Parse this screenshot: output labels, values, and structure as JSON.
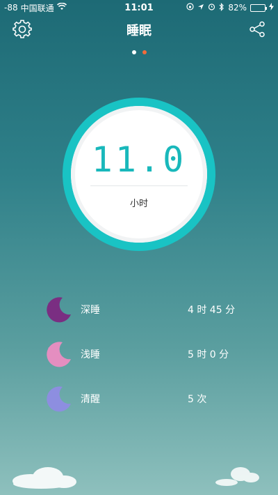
{
  "status_bar": {
    "signal": "-88",
    "carrier": "中国联通",
    "time": "11:01",
    "battery": "82%",
    "battery_level": 0.82
  },
  "nav": {
    "title": "睡眠",
    "settings_icon": "gear-icon",
    "share_icon": "share-icon"
  },
  "pager": {
    "count": 2,
    "active": 1,
    "inactive_color": "#ffffff",
    "active_color": "#f26b3a"
  },
  "summary": {
    "value": "11.0",
    "unit": "小时",
    "ring_color": "#19c3c4"
  },
  "stats": [
    {
      "label": "深睡",
      "value": "4 时 45 分",
      "icon": "moon-deep-sleep-icon",
      "color": "#7a2e82"
    },
    {
      "label": "浅睡",
      "value": "5 时 0 分",
      "icon": "moon-light-sleep-icon",
      "color": "#e48ec0"
    },
    {
      "label": "清醒",
      "value": "5 次",
      "icon": "moon-awake-icon",
      "color": "#8d8ee0"
    }
  ]
}
